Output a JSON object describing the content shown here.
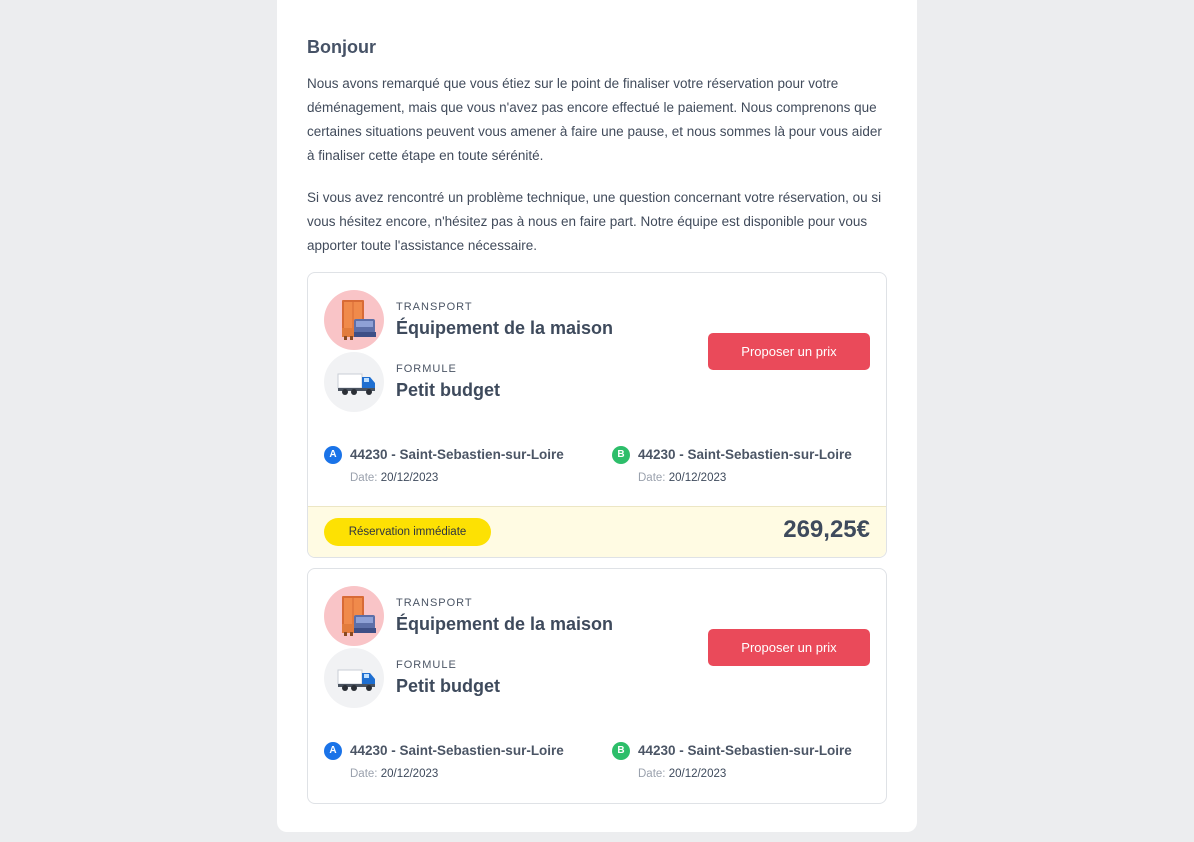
{
  "email": {
    "greeting": "Bonjour",
    "paragraphs": [
      "Nous avons remarqué que vous étiez sur le point de finaliser votre réservation pour votre déménagement, mais que vous n'avez pas encore effectué le paiement. Nous comprenons que certaines situations peuvent vous amener à faire une pause, et nous sommes là pour vous aider à finaliser cette étape en toute sérénité.",
      "Si vous avez rencontré un problème technique, une question concernant votre réservation, ou si vous hésitez encore, n'hésitez pas à nous en faire part. Notre équipe est disponible pour vous apporter toute l'assistance nécessaire."
    ]
  },
  "cards": [
    {
      "transport_label": "TRANSPORT",
      "transport_value": "Équipement de la maison",
      "formula_label": "FORMULE",
      "formula_value": "Petit budget",
      "button_label": "Proposer un prix",
      "origin": {
        "marker": "A",
        "city": "44230 - Saint-Sebastien-sur-Loire",
        "date_label": "Date:",
        "date": "20/12/2023"
      },
      "destination": {
        "marker": "B",
        "city": "44230 - Saint-Sebastien-sur-Loire",
        "date_label": "Date:",
        "date": "20/12/2023"
      },
      "badge": "Réservation immédiate",
      "price": "269,25€"
    },
    {
      "transport_label": "TRANSPORT",
      "transport_value": "Équipement de la maison",
      "formula_label": "FORMULE",
      "formula_value": "Petit budget",
      "button_label": "Proposer un prix",
      "origin": {
        "marker": "A",
        "city": "44230 - Saint-Sebastien-sur-Loire",
        "date_label": "Date:",
        "date": "20/12/2023"
      },
      "destination": {
        "marker": "B",
        "city": "44230 - Saint-Sebastien-sur-Loire",
        "date_label": "Date:",
        "date": "20/12/2023"
      }
    }
  ],
  "icons": {
    "transport": "furniture-icon",
    "formula": "truck-icon"
  },
  "colors": {
    "button": "#ea4a5a",
    "badge": "#fde103",
    "pin_a": "#1a73e8",
    "pin_b": "#2dbe6a",
    "footer_bg": "#fffbe3"
  }
}
